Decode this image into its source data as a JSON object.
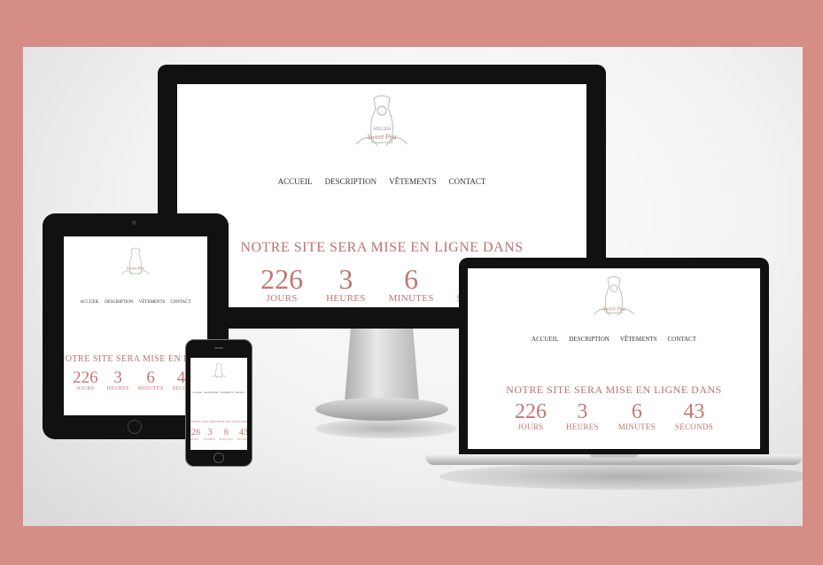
{
  "site": {
    "logo": {
      "line1": "ATELIER",
      "line2": "Sweet Pea"
    },
    "nav": [
      "ACCUEIL",
      "DESCRIPTION",
      "VÊTEMENTS",
      "CONTACT"
    ],
    "headline": "NOTRE SITE SERA MISE EN LIGNE DANS",
    "countdown": [
      {
        "value": "226",
        "label": "JOURS"
      },
      {
        "value": "3",
        "label": "HEURES"
      },
      {
        "value": "6",
        "label": "MINUTES"
      },
      {
        "value": "43",
        "label": "SECONDS"
      }
    ]
  },
  "colors": {
    "accent": "#c47674",
    "border": "#d68d86"
  }
}
